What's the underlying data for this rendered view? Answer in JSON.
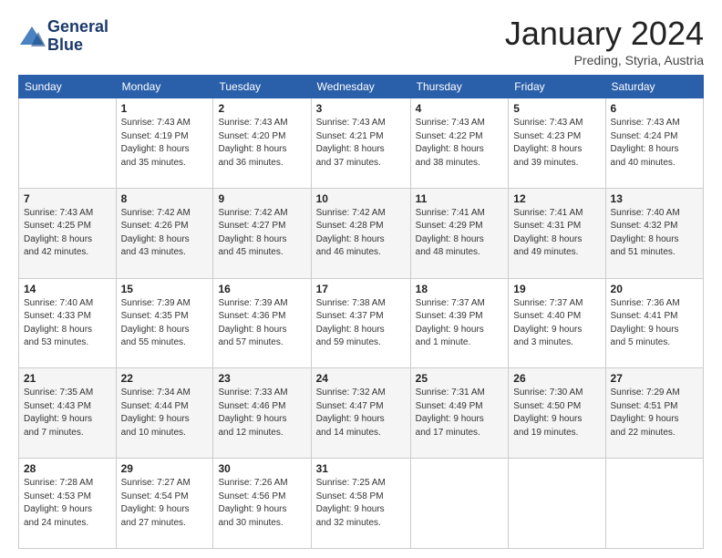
{
  "header": {
    "logo_line1": "General",
    "logo_line2": "Blue",
    "month_title": "January 2024",
    "location": "Preding, Styria, Austria"
  },
  "days_of_week": [
    "Sunday",
    "Monday",
    "Tuesday",
    "Wednesday",
    "Thursday",
    "Friday",
    "Saturday"
  ],
  "weeks": [
    [
      {
        "day": "",
        "info": ""
      },
      {
        "day": "1",
        "info": "Sunrise: 7:43 AM\nSunset: 4:19 PM\nDaylight: 8 hours\nand 35 minutes."
      },
      {
        "day": "2",
        "info": "Sunrise: 7:43 AM\nSunset: 4:20 PM\nDaylight: 8 hours\nand 36 minutes."
      },
      {
        "day": "3",
        "info": "Sunrise: 7:43 AM\nSunset: 4:21 PM\nDaylight: 8 hours\nand 37 minutes."
      },
      {
        "day": "4",
        "info": "Sunrise: 7:43 AM\nSunset: 4:22 PM\nDaylight: 8 hours\nand 38 minutes."
      },
      {
        "day": "5",
        "info": "Sunrise: 7:43 AM\nSunset: 4:23 PM\nDaylight: 8 hours\nand 39 minutes."
      },
      {
        "day": "6",
        "info": "Sunrise: 7:43 AM\nSunset: 4:24 PM\nDaylight: 8 hours\nand 40 minutes."
      }
    ],
    [
      {
        "day": "7",
        "info": "Sunrise: 7:43 AM\nSunset: 4:25 PM\nDaylight: 8 hours\nand 42 minutes."
      },
      {
        "day": "8",
        "info": "Sunrise: 7:42 AM\nSunset: 4:26 PM\nDaylight: 8 hours\nand 43 minutes."
      },
      {
        "day": "9",
        "info": "Sunrise: 7:42 AM\nSunset: 4:27 PM\nDaylight: 8 hours\nand 45 minutes."
      },
      {
        "day": "10",
        "info": "Sunrise: 7:42 AM\nSunset: 4:28 PM\nDaylight: 8 hours\nand 46 minutes."
      },
      {
        "day": "11",
        "info": "Sunrise: 7:41 AM\nSunset: 4:29 PM\nDaylight: 8 hours\nand 48 minutes."
      },
      {
        "day": "12",
        "info": "Sunrise: 7:41 AM\nSunset: 4:31 PM\nDaylight: 8 hours\nand 49 minutes."
      },
      {
        "day": "13",
        "info": "Sunrise: 7:40 AM\nSunset: 4:32 PM\nDaylight: 8 hours\nand 51 minutes."
      }
    ],
    [
      {
        "day": "14",
        "info": "Sunrise: 7:40 AM\nSunset: 4:33 PM\nDaylight: 8 hours\nand 53 minutes."
      },
      {
        "day": "15",
        "info": "Sunrise: 7:39 AM\nSunset: 4:35 PM\nDaylight: 8 hours\nand 55 minutes."
      },
      {
        "day": "16",
        "info": "Sunrise: 7:39 AM\nSunset: 4:36 PM\nDaylight: 8 hours\nand 57 minutes."
      },
      {
        "day": "17",
        "info": "Sunrise: 7:38 AM\nSunset: 4:37 PM\nDaylight: 8 hours\nand 59 minutes."
      },
      {
        "day": "18",
        "info": "Sunrise: 7:37 AM\nSunset: 4:39 PM\nDaylight: 9 hours\nand 1 minute."
      },
      {
        "day": "19",
        "info": "Sunrise: 7:37 AM\nSunset: 4:40 PM\nDaylight: 9 hours\nand 3 minutes."
      },
      {
        "day": "20",
        "info": "Sunrise: 7:36 AM\nSunset: 4:41 PM\nDaylight: 9 hours\nand 5 minutes."
      }
    ],
    [
      {
        "day": "21",
        "info": "Sunrise: 7:35 AM\nSunset: 4:43 PM\nDaylight: 9 hours\nand 7 minutes."
      },
      {
        "day": "22",
        "info": "Sunrise: 7:34 AM\nSunset: 4:44 PM\nDaylight: 9 hours\nand 10 minutes."
      },
      {
        "day": "23",
        "info": "Sunrise: 7:33 AM\nSunset: 4:46 PM\nDaylight: 9 hours\nand 12 minutes."
      },
      {
        "day": "24",
        "info": "Sunrise: 7:32 AM\nSunset: 4:47 PM\nDaylight: 9 hours\nand 14 minutes."
      },
      {
        "day": "25",
        "info": "Sunrise: 7:31 AM\nSunset: 4:49 PM\nDaylight: 9 hours\nand 17 minutes."
      },
      {
        "day": "26",
        "info": "Sunrise: 7:30 AM\nSunset: 4:50 PM\nDaylight: 9 hours\nand 19 minutes."
      },
      {
        "day": "27",
        "info": "Sunrise: 7:29 AM\nSunset: 4:51 PM\nDaylight: 9 hours\nand 22 minutes."
      }
    ],
    [
      {
        "day": "28",
        "info": "Sunrise: 7:28 AM\nSunset: 4:53 PM\nDaylight: 9 hours\nand 24 minutes."
      },
      {
        "day": "29",
        "info": "Sunrise: 7:27 AM\nSunset: 4:54 PM\nDaylight: 9 hours\nand 27 minutes."
      },
      {
        "day": "30",
        "info": "Sunrise: 7:26 AM\nSunset: 4:56 PM\nDaylight: 9 hours\nand 30 minutes."
      },
      {
        "day": "31",
        "info": "Sunrise: 7:25 AM\nSunset: 4:58 PM\nDaylight: 9 hours\nand 32 minutes."
      },
      {
        "day": "",
        "info": ""
      },
      {
        "day": "",
        "info": ""
      },
      {
        "day": "",
        "info": ""
      }
    ]
  ]
}
